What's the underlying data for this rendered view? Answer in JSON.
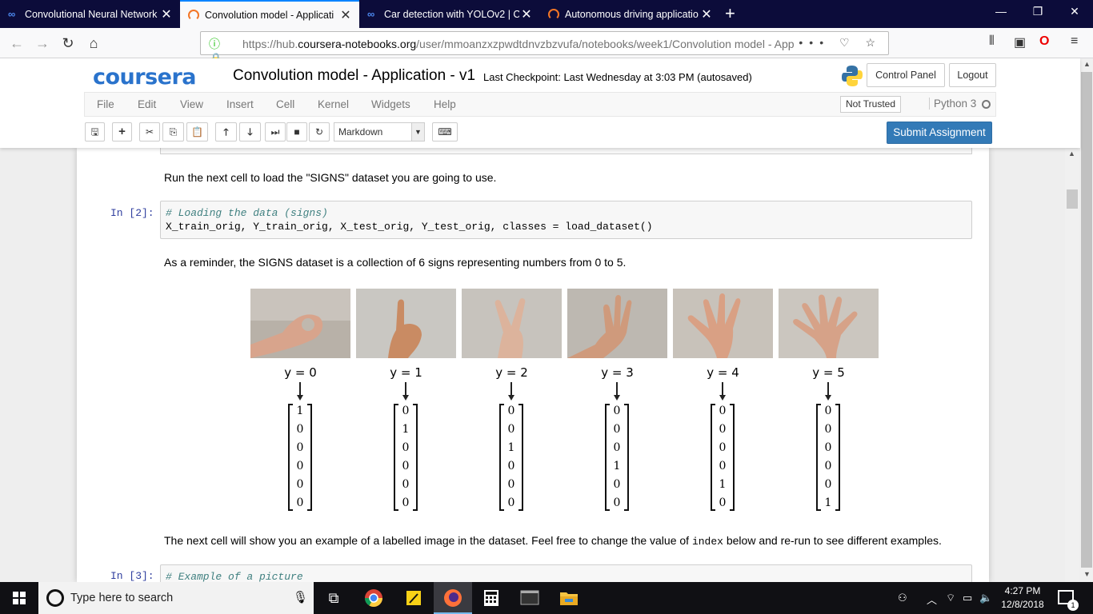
{
  "browser": {
    "tabs": [
      {
        "title": "Convolutional Neural Network",
        "icon": "coursera-icon",
        "active": false
      },
      {
        "title": "Convolution model - Applicati",
        "icon": "jupyter-icon",
        "active": true
      },
      {
        "title": "Car detection with YOLOv2 | Co",
        "icon": "coursera-icon",
        "active": false
      },
      {
        "title": "Autonomous driving applicatio",
        "icon": "jupyter-icon",
        "active": false
      }
    ],
    "url_prefix": "https://hub.",
    "url_domain": "coursera-notebooks.org",
    "url_path": "/user/mmoanzxzpwdtdnvzbzvufa/notebooks/week1/Convolution model - App"
  },
  "jupyter": {
    "logo": "coursera",
    "notebook_title": "Convolution model - Application - v1",
    "checkpoint": "Last Checkpoint: Last Wednesday at 3:03 PM (autosaved)",
    "control_panel": "Control Panel",
    "logout": "Logout",
    "menu": [
      "File",
      "Edit",
      "View",
      "Insert",
      "Cell",
      "Kernel",
      "Widgets",
      "Help"
    ],
    "trust": "Not Trusted",
    "kernel": "Python 3",
    "cell_type": "Markdown",
    "submit": "Submit Assignment"
  },
  "notebook": {
    "md1": "Run the next cell to load the \"SIGNS\" dataset you are going to use.",
    "cell2_prompt": "In [2]:",
    "cell2_comment": "# Loading the data (signs)",
    "cell2_code": "X_train_orig, Y_train_orig, X_test_orig, Y_test_orig, classes = load_dataset()",
    "md2": "As a reminder, the SIGNS dataset is a collection of 6 signs representing numbers from 0 to 5.",
    "signs": [
      {
        "label": "y = 0",
        "vector": [
          "1",
          "0",
          "0",
          "0",
          "0",
          "0"
        ]
      },
      {
        "label": "y = 1",
        "vector": [
          "0",
          "1",
          "0",
          "0",
          "0",
          "0"
        ]
      },
      {
        "label": "y = 2",
        "vector": [
          "0",
          "0",
          "1",
          "0",
          "0",
          "0"
        ]
      },
      {
        "label": "y = 3",
        "vector": [
          "0",
          "0",
          "0",
          "1",
          "0",
          "0"
        ]
      },
      {
        "label": "y = 4",
        "vector": [
          "0",
          "0",
          "0",
          "0",
          "1",
          "0"
        ]
      },
      {
        "label": "y = 5",
        "vector": [
          "0",
          "0",
          "0",
          "0",
          "0",
          "1"
        ]
      }
    ],
    "md3_a": "The next cell will show you an example of a labelled image in the dataset. Feel free to change the value of ",
    "md3_code": "index",
    "md3_b": " below and re-run to see different examples.",
    "cell3_prompt": "In [3]:",
    "cell3_comment": "# Example of a picture"
  },
  "taskbar": {
    "search_placeholder": "Type here to search",
    "time": "4:27 PM",
    "date": "12/8/2018",
    "notification_count": "1"
  }
}
